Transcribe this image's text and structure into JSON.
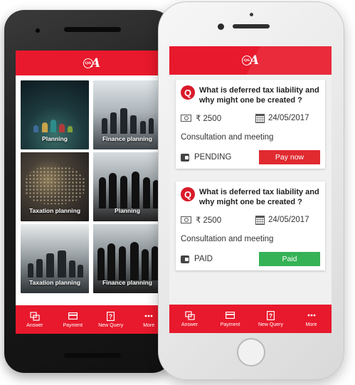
{
  "brand": {
    "logo_small": "Q&A",
    "logo_big": "QA",
    "accent": "#e8192c"
  },
  "android": {
    "tiles": [
      {
        "label": "Planning"
      },
      {
        "label": "Finance planning"
      },
      {
        "label": "Taxation planning"
      },
      {
        "label": "Planning"
      },
      {
        "label": "Taxation planning"
      },
      {
        "label": "Finance planning"
      }
    ]
  },
  "nav": [
    {
      "label": "Answer",
      "icon": "answer-icon"
    },
    {
      "label": "Payment",
      "icon": "card-icon"
    },
    {
      "label": "New Query",
      "icon": "question-icon"
    },
    {
      "label": "More",
      "icon": "more-icon"
    }
  ],
  "cards": [
    {
      "q_icon": "Q",
      "question": "What is deferred tax liability and why might one be created ?",
      "amount": "₹ 2500",
      "date": "24/05/2017",
      "service": "Consultation and meeting",
      "status": "PENDING",
      "action": "Pay now",
      "action_color": "#e02a30"
    },
    {
      "q_icon": "Q",
      "question": "What is deferred tax liability and why might one be created ?",
      "amount": "₹ 2500",
      "date": "24/05/2017",
      "service": "Consultation and meeting",
      "status": "PAID",
      "action": "Paid",
      "action_color": "#34b255"
    }
  ]
}
